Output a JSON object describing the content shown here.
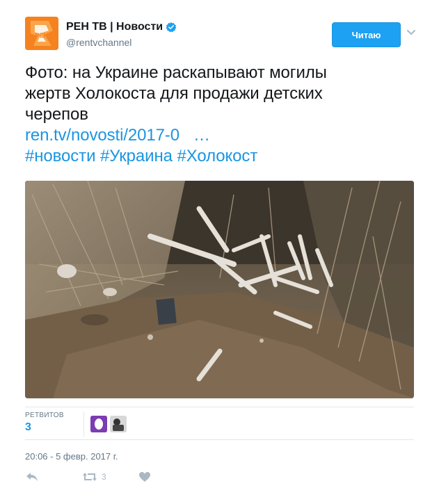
{
  "account": {
    "display_name": "РЕН ТВ | Новости",
    "handle": "@rentvchannel",
    "avatar_text": "РЕН"
  },
  "follow_button": {
    "label": "Читаю"
  },
  "tweet": {
    "text_lines": [
      "Фото: на Украине раскапывают могилы",
      "жертв Холокоста для продажи детских",
      "черепов"
    ],
    "link": "ren.tv/novosti/2017-0",
    "link_ellipsis": "…",
    "hashtags": [
      "#новости",
      "#Украина",
      "#Холокост"
    ]
  },
  "stats": {
    "retweets_label": "РЕТВИТОВ",
    "retweets_count": "3"
  },
  "timestamp": "20:06 - 5 февр. 2017 г.",
  "actions": {
    "retweet_count": "3"
  },
  "colors": {
    "accent": "#1da1f2",
    "link": "#1b95e0",
    "muted": "#657786",
    "brand": "#f5821f"
  },
  "icons": [
    "verified-icon",
    "caret-down-icon",
    "reply-icon",
    "retweet-icon",
    "like-icon"
  ]
}
